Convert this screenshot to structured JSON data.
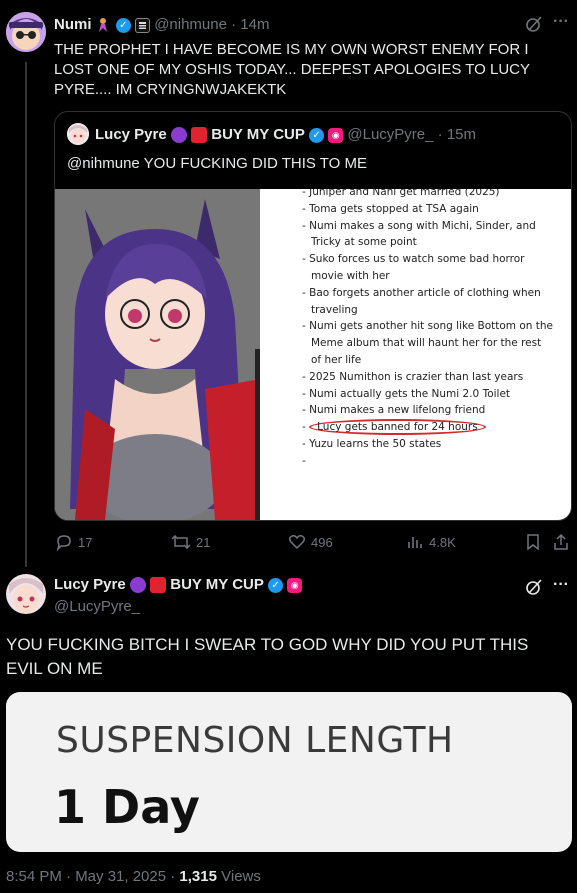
{
  "tweet1": {
    "display_name": "Numi",
    "handle": "@nihmune",
    "time": "· 14m",
    "text": "THE PROPHET I HAVE BECOME IS MY OWN WORST ENEMY FOR I LOST ONE OF MY OSHIS TODAY... DEEPEST APOLOGIES TO LUCY PYRE.... IM CRYINGNWJAKEKTK"
  },
  "quoted": {
    "display_name": "Lucy Pyre",
    "badge_text": "BUY MY CUP",
    "handle": "@LucyPyre_",
    "time": "· 15m",
    "text": "@nihmune YOU FUCKING DID THIS TO ME",
    "image_list": [
      "Juniper and Nani get married (2025)",
      "Toma gets stopped at TSA again",
      "Numi makes a song with Michi, Sinder, and",
      "Tricky at some point",
      "Suko forces us to watch some bad horror",
      "movie with her",
      "Bao forgets another article of clothing when",
      "traveling",
      "Numi gets another hit song like Bottom on the",
      "Meme album that will haunt her for the rest",
      "of her life",
      "2025 Numithon is crazier than last years",
      "Numi actually gets the Numi 2.0 Toilet",
      "Numi makes a new lifelong friend",
      "Lucy gets banned for 24 hours",
      "Yuzu learns the 50 states",
      ""
    ]
  },
  "metrics": {
    "replies": "17",
    "reposts": "21",
    "likes": "496",
    "views": "4.8K"
  },
  "tweet2": {
    "display_name": "Lucy Pyre",
    "badge_text": "BUY MY CUP",
    "handle": "@LucyPyre_",
    "text": "YOU FUCKING BITCH I SWEAR TO GOD WHY DID YOU PUT THIS EVIL ON ME",
    "image_heading": "SUSPENSION LENGTH",
    "image_value": "1 Day",
    "timestamp": "8:54 PM · May 31, 2025 · ",
    "views_count": "1,315",
    "views_label": " Views"
  },
  "icons": {
    "more": "more-horizontal-icon",
    "grok": "grok-icon",
    "reply": "reply-icon",
    "repost": "repost-icon",
    "like": "heart-icon",
    "views": "views-icon",
    "bookmark": "bookmark-icon",
    "share": "share-icon"
  },
  "colors": {
    "background": "#000000",
    "text": "#e7e9ea",
    "muted": "#71767b",
    "verified": "#1d9bf0",
    "circle_highlight": "#d22b2b"
  }
}
